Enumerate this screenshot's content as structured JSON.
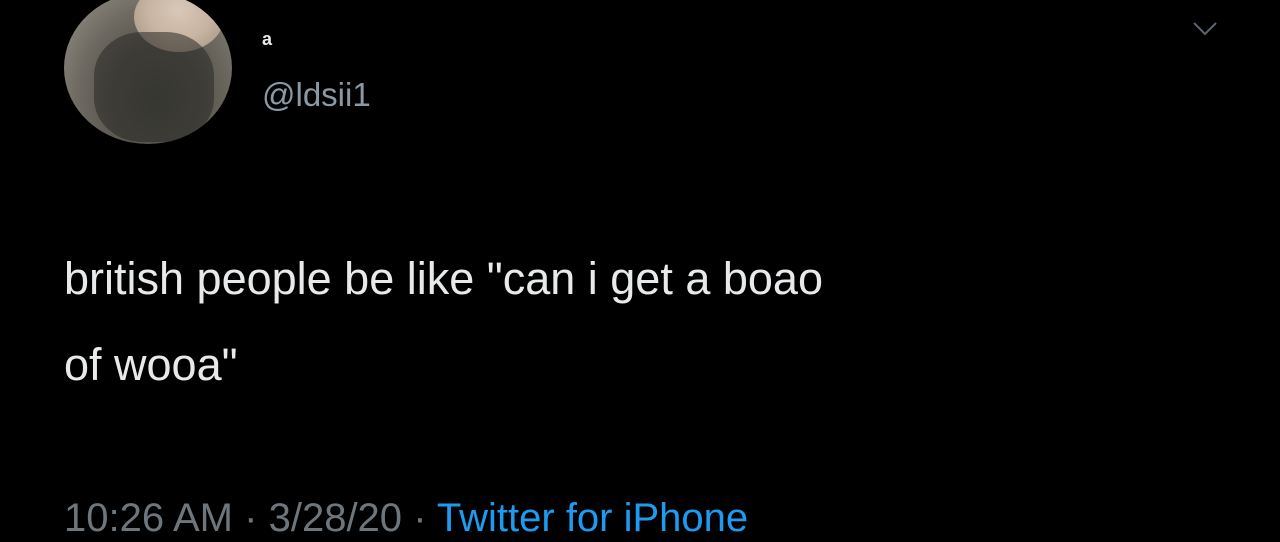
{
  "tweet": {
    "author": {
      "display_name": "a",
      "handle": "@ldsii1"
    },
    "text_line_1": "british people be like \"can i get a boao",
    "text_line_2": "of wooa\"",
    "meta": {
      "time": "10:26 AM",
      "separator": "·",
      "date": "3/28/20",
      "source": "Twitter for iPhone"
    },
    "icons": {
      "menu": "chevron-down-icon"
    }
  },
  "colors": {
    "background": "#000000",
    "text": "#e7e9ea",
    "secondary": "#6e767d",
    "link": "#1d9bf0"
  }
}
